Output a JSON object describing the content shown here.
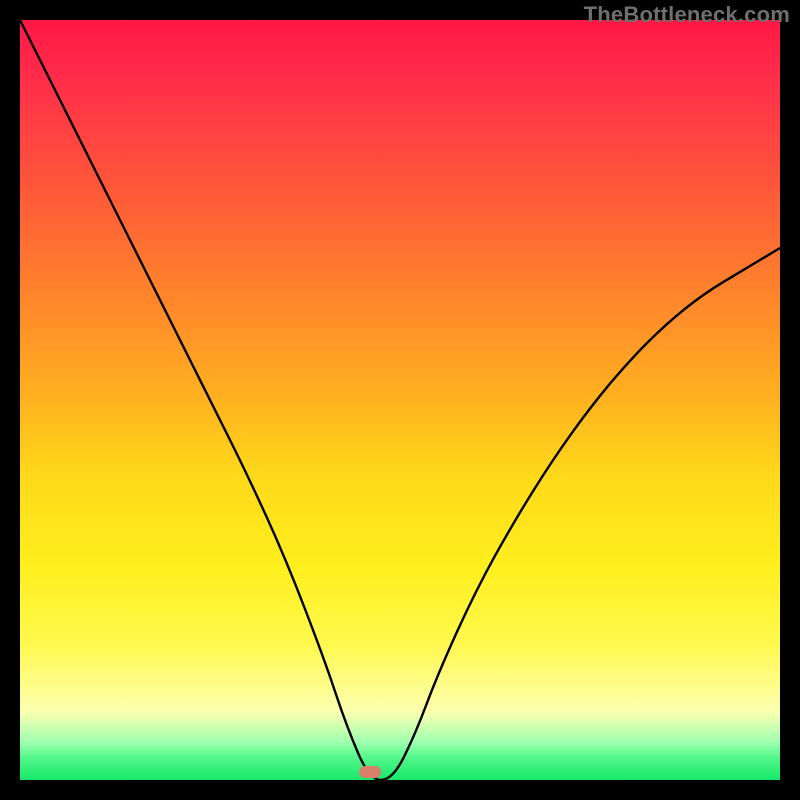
{
  "watermark": "TheBottleneck.com",
  "marker": {
    "x_pct": 46,
    "y_pct": 99,
    "color": "#d88068"
  },
  "chart_data": {
    "type": "line",
    "title": "",
    "xlabel": "",
    "ylabel": "",
    "xlim": [
      0,
      100
    ],
    "ylim": [
      0,
      100
    ],
    "grid": false,
    "legend": false,
    "background": {
      "gradient": "vertical",
      "stops": [
        {
          "pct": 0,
          "color": "#ff1744"
        },
        {
          "pct": 18,
          "color": "#ff4b3e"
        },
        {
          "pct": 38,
          "color": "#ff8a2a"
        },
        {
          "pct": 60,
          "color": "#ffd91a"
        },
        {
          "pct": 82,
          "color": "#fff94d"
        },
        {
          "pct": 95,
          "color": "#9fffb0"
        },
        {
          "pct": 100,
          "color": "#17e86a"
        }
      ]
    },
    "series": [
      {
        "name": "bottleneck-curve",
        "color": "#000000",
        "x": [
          0,
          5,
          10,
          15,
          20,
          25,
          30,
          35,
          40,
          43,
          46,
          49,
          52,
          55,
          60,
          65,
          70,
          75,
          80,
          85,
          90,
          95,
          100
        ],
        "y": [
          100,
          90,
          80,
          70,
          60,
          50,
          40,
          29,
          16,
          7,
          0,
          0,
          6,
          14,
          25,
          34,
          42,
          49,
          55,
          60,
          64,
          67,
          70
        ]
      }
    ],
    "marker": {
      "x": 46,
      "y": 0,
      "color": "#d88068",
      "shape": "rounded-pill"
    }
  }
}
